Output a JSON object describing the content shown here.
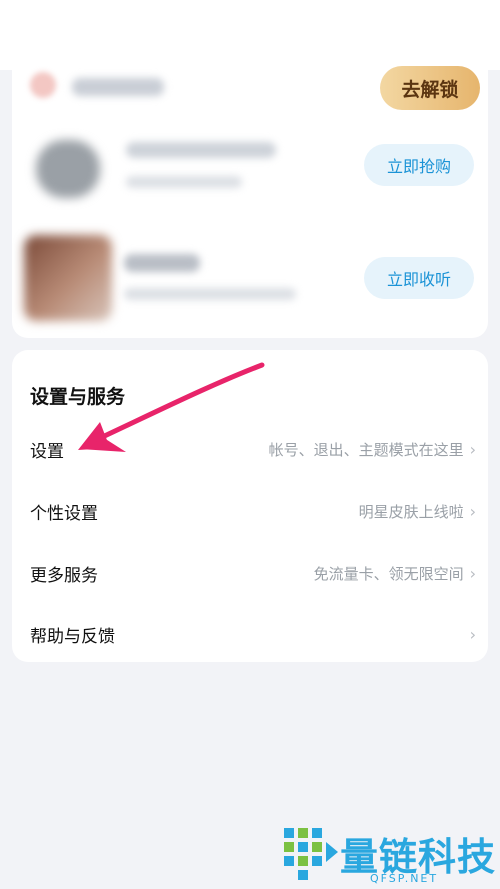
{
  "top_card": {
    "unlock_button": "去解锁",
    "items": [
      {
        "action": "立即抢购"
      },
      {
        "action": "立即收听"
      }
    ]
  },
  "settings": {
    "title": "设置与服务",
    "rows": [
      {
        "label": "设置",
        "hint": "帐号、退出、主题模式在这里"
      },
      {
        "label": "个性设置",
        "hint": "明星皮肤上线啦"
      },
      {
        "label": "更多服务",
        "hint": "免流量卡、领无限空间"
      },
      {
        "label": "帮助与反馈",
        "hint": ""
      }
    ],
    "chevron": "›"
  },
  "annotation": {
    "arrow_color": "#e8246a"
  },
  "watermark": {
    "brand": "量链科技",
    "domain": "QFSP.NET",
    "brand_color": "#2aa7df"
  }
}
